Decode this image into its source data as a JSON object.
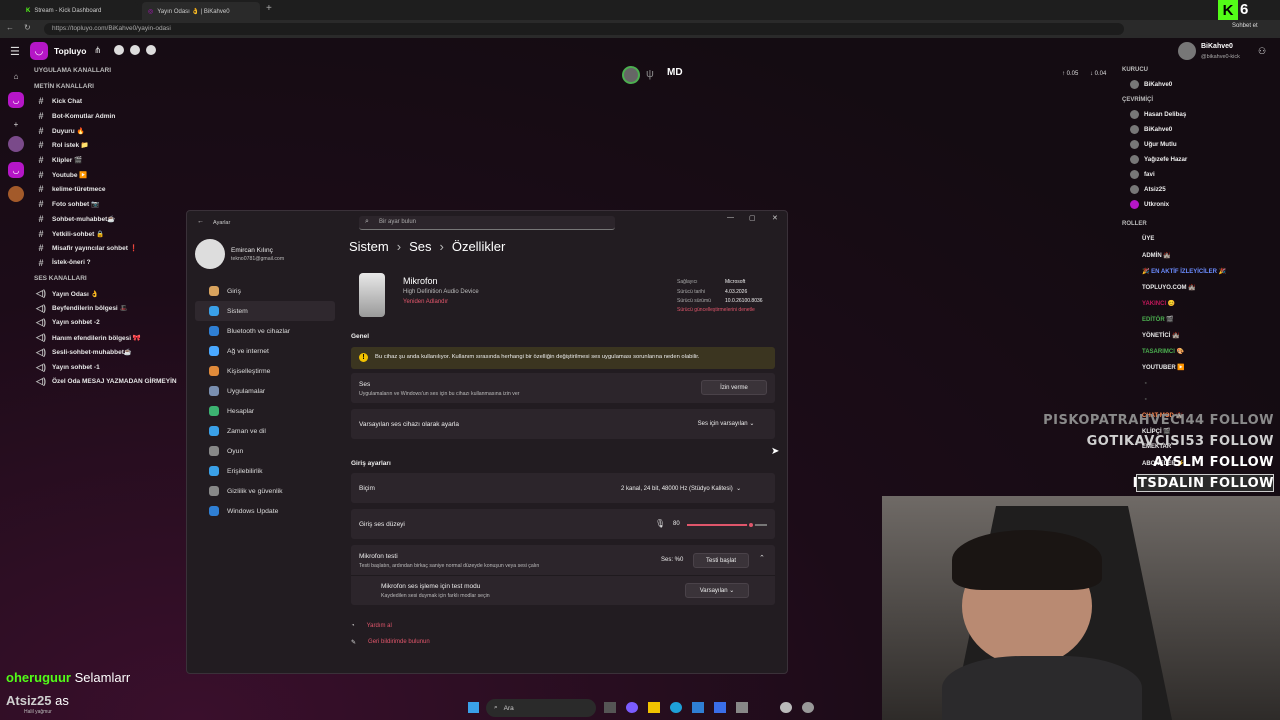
{
  "browser": {
    "tabs": [
      {
        "label": "Stream - Kick Dashboard"
      },
      {
        "label": "Yayın Odası 👌 | BiKahve0"
      }
    ],
    "url": "https://topluyo.com/BiKahve0/yayin-odasi",
    "chat_button": "Sohbet et",
    "kick_count": "6"
  },
  "app": {
    "name": "Topluyo",
    "sections": {
      "app_channels": "UYGULAMA KANALLARI",
      "text_channels": "METİN KANALLARI",
      "voice_channels": "SES KANALLARI"
    },
    "text_channels": [
      "Kick Chat",
      "Bot-Komutlar Admin",
      "Duyuru 🔥",
      "Rol istek 📁",
      "Klipler 🎬",
      "Youtube ▶️",
      "kelime-türetmece",
      "Foto sohbet 📷",
      "Sohbet-muhabbet☕",
      "Yetkili-sohbet 🔒",
      "Misafir yayıncılar sohbet ❗",
      "İstek-öneri ?"
    ],
    "voice_channels": [
      "Yayın Odası 👌",
      "Beyfendilerin bölgesi 🎩",
      "Yayın sohbet -2",
      "Hanım efendilerin bölgesi 🎀",
      "Sesli-sohbet-muhabbet☕",
      "Yayın sohbet -1",
      "Özel Oda MESAJ YAZMADAN GİRMEYİN"
    ]
  },
  "top_stats": {
    "up": "0.05",
    "down": "0.04"
  },
  "profile": {
    "name": "BiKahve0",
    "handle": "@bikahve0-kick"
  },
  "members": {
    "founder_label": "KURUCU",
    "founder": "BiKahve0",
    "online_label": "ÇEVRİMİÇİ",
    "online": [
      "Hasan Delibaş",
      "BiKahve0",
      "Uğur Mutlu",
      "Yağızefe Hazar",
      "favi",
      "Atsiz25",
      "Utkronix"
    ],
    "roles_label": "ROLLER",
    "roles": [
      {
        "name": "ÜYE",
        "color": "#e8e8e8"
      },
      {
        "name": "ADMİN 🏰",
        "color": "#e8e8e8"
      },
      {
        "name": "🎉 EN AKTİF İZLEYİCİLER 🎉",
        "color": "#6b8cff"
      },
      {
        "name": "TOPLUYO.COM 🏰",
        "color": "#e8e8e8"
      },
      {
        "name": "YAKINCI 😊",
        "color": "#c2185b"
      },
      {
        "name": "EDİTÖR 🎬",
        "color": "#4caf50"
      },
      {
        "name": "YÖNETİCİ 🏰",
        "color": "#e8e8e8"
      },
      {
        "name": "TASARIMCI 🎨",
        "color": "#4caf50"
      },
      {
        "name": "YOUTUBER ▶️",
        "color": "#e8e8e8"
      },
      {
        "name": "▪️",
        "color": "#4a7bd8"
      },
      {
        "name": "▪️",
        "color": "#e05fa0"
      },
      {
        "name": "CHAT MOD 🏰",
        "color": "#ff8a50"
      },
      {
        "name": "KLİPÇİ 🎬",
        "color": "#e8e8e8"
      },
      {
        "name": "EMEKTAR",
        "color": "#e8e8e8"
      },
      {
        "name": "ABONELER ⚡",
        "color": "#e8e8e8"
      }
    ]
  },
  "follows": [
    "PISKOPATRAHVECI44 FOLLOW",
    "GOTIKAVCISI53 FOLLOW",
    "AYSLM FOLLOW",
    "ITSDALIN FOLLOW"
  ],
  "chat_overlay": [
    {
      "user": "oheruguur",
      "text": "Selamlarr"
    },
    {
      "user": "Atsiz25",
      "text": "as"
    }
  ],
  "chat_overlay_sub": "Halil yağmur",
  "settings": {
    "window_title": "Ayarlar",
    "search_placeholder": "Bir ayar bulun",
    "user_name": "Emircan Kılınç",
    "user_email": "tekno0781@gmail.com",
    "nav": [
      {
        "label": "Giriş",
        "color": "#d9a35e"
      },
      {
        "label": "Sistem",
        "color": "#3aa0e8"
      },
      {
        "label": "Bluetooth ve cihazlar",
        "color": "#2f7fd4"
      },
      {
        "label": "Ağ ve internet",
        "color": "#4aa8ff"
      },
      {
        "label": "Kişiselleştirme",
        "color": "#e08a3a"
      },
      {
        "label": "Uygulamalar",
        "color": "#7a8fb0"
      },
      {
        "label": "Hesaplar",
        "color": "#3cb371"
      },
      {
        "label": "Zaman ve dil",
        "color": "#3aa0e8"
      },
      {
        "label": "Oyun",
        "color": "#888888"
      },
      {
        "label": "Erişilebilirlik",
        "color": "#3aa0e8"
      },
      {
        "label": "Gizlilik ve güvenlik",
        "color": "#888888"
      },
      {
        "label": "Windows Update",
        "color": "#2f7fd4"
      }
    ],
    "breadcrumb": [
      "Sistem",
      "Ses",
      "Özellikler"
    ],
    "device": {
      "name": "Mikrofon",
      "desc": "High Definition Audio Device",
      "rename": "Yeniden Adlandır",
      "provider_label": "Sağlayıcı",
      "provider": "Microsoft",
      "date_label": "Sürücü tarihi",
      "date": "4.03.2026",
      "version_label": "Sürücü sürümü",
      "version": "10.0.26100.8036",
      "update_link": "Sürücü güncelleştirmelerini denetle"
    },
    "general_label": "Genel",
    "warning": "Bu cihaz şu anda kullanılıyor. Kullanım sırasında herhangi bir özelliğin değiştirilmesi ses uygulaması sorunlarına neden olabilir.",
    "audio_title": "Ses",
    "audio_sub": "Uygulamaların ve Windows'un ses için bu cihazı kullanmasına izin ver",
    "audio_btn": "İzin verme",
    "default_label": "Varsayılan ses cihazı olarak ayarla",
    "default_value": "Ses için varsayılan",
    "input_settings": "Giriş ayarları",
    "format_label": "Biçim",
    "format_value": "2 kanal, 24 bit, 48000 Hz (Stüdyo Kalitesi)",
    "volume_label": "Giriş ses düzeyi",
    "volume_value": "80",
    "volume": 0.8,
    "test_title": "Mikrofon testi",
    "test_sub": "Testi başlatın, ardından birkaç saniye normal düzeyde konuşun veya sesi çalın",
    "test_level": "Ses: %0",
    "test_btn": "Testi başlat",
    "mode_title": "Mikrofon ses işleme için test modu",
    "mode_sub": "Kaydedilen sesi duymak için farklı modlar seçin",
    "mode_value": "Varsayılan",
    "help": "Yardım al",
    "feedback": "Geri bildirimde bulunun"
  },
  "taskbar": {
    "search": "Ara"
  },
  "colors": {
    "accent": "#b516c7",
    "slider": "#e0566b",
    "warn_bg": "#3b3520"
  }
}
